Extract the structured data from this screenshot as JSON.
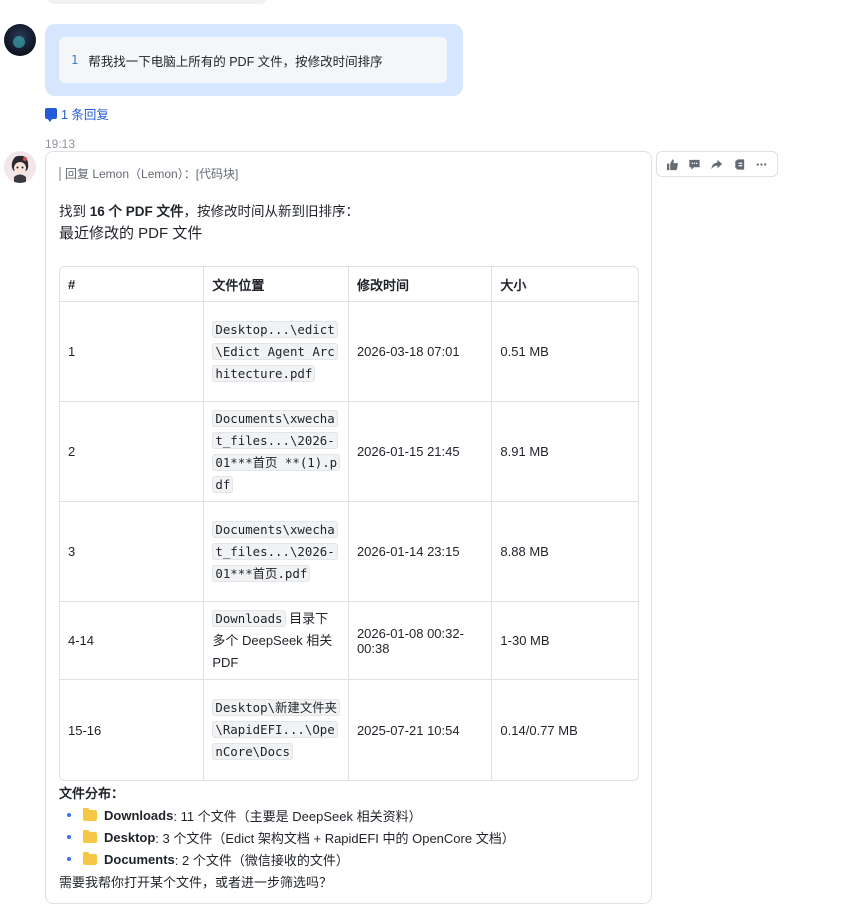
{
  "user_message": {
    "line_number": "1",
    "text": "帮我找一下电脑上所有的 PDF 文件，按修改时间排序"
  },
  "reply_count": "1 条回复",
  "timestamp": "19:13",
  "bot_message": {
    "quote": "回复 Lemon（Lemon）：[代码块]",
    "intro_prefix": "找到 ",
    "intro_bold": "16 个 PDF 文件",
    "intro_suffix": "，按修改时间从新到旧排序：",
    "heading": "最近修改的 PDF 文件",
    "table": {
      "headers": [
        "#",
        "文件位置",
        "修改时间",
        "大小"
      ],
      "rows": [
        {
          "num": "1",
          "loc_code": "Desktop...\\edict\\Edict Agent Architecture.pdf",
          "loc_text": "",
          "time": "2026-03-18 07:01",
          "size": "0.51 MB"
        },
        {
          "num": "2",
          "loc_code": "Documents\\xwechat_files...\\2026-01***首页 **(1).pdf",
          "loc_text": "",
          "time": "2026-01-15 21:45",
          "size": "8.91 MB"
        },
        {
          "num": "3",
          "loc_code": "Documents\\xwechat_files...\\2026-01***首页.pdf",
          "loc_text": "",
          "time": "2026-01-14 23:15",
          "size": "8.88 MB"
        },
        {
          "num": "4-14",
          "loc_code": "Downloads",
          "loc_text": " 目录下多个 DeepSeek 相关 PDF",
          "time": "2026-01-08 00:32-00:38",
          "size": "1-30 MB"
        },
        {
          "num": "15-16",
          "loc_code": "Desktop\\新建文件夹\\RapidEFI...\\OpenCore\\Docs",
          "loc_text": "",
          "time": "2025-07-21 10:54",
          "size": "0.14/0.77 MB"
        }
      ]
    },
    "distribution_title": "文件分布：",
    "distribution": [
      {
        "name": "Downloads",
        "detail": ": 11 个文件（主要是 DeepSeek 相关资料）"
      },
      {
        "name": "Desktop",
        "detail": ": 3 个文件（Edict 架构文档 + RapidEFI 中的 OpenCore 文档）"
      },
      {
        "name": "Documents",
        "detail": ": 2 个文件（微信接收的文件）"
      }
    ],
    "closing": "需要我帮你打开某个文件，或者进一步筛选吗？"
  },
  "toolbar": {
    "icons": [
      "thumbs-up-icon",
      "comment-icon",
      "forward-icon",
      "pin-icon",
      "more-icon"
    ]
  },
  "colors": {
    "user_bubble": "#d6e6fe",
    "link_blue": "#245bdb",
    "folder": "#f6c744"
  }
}
